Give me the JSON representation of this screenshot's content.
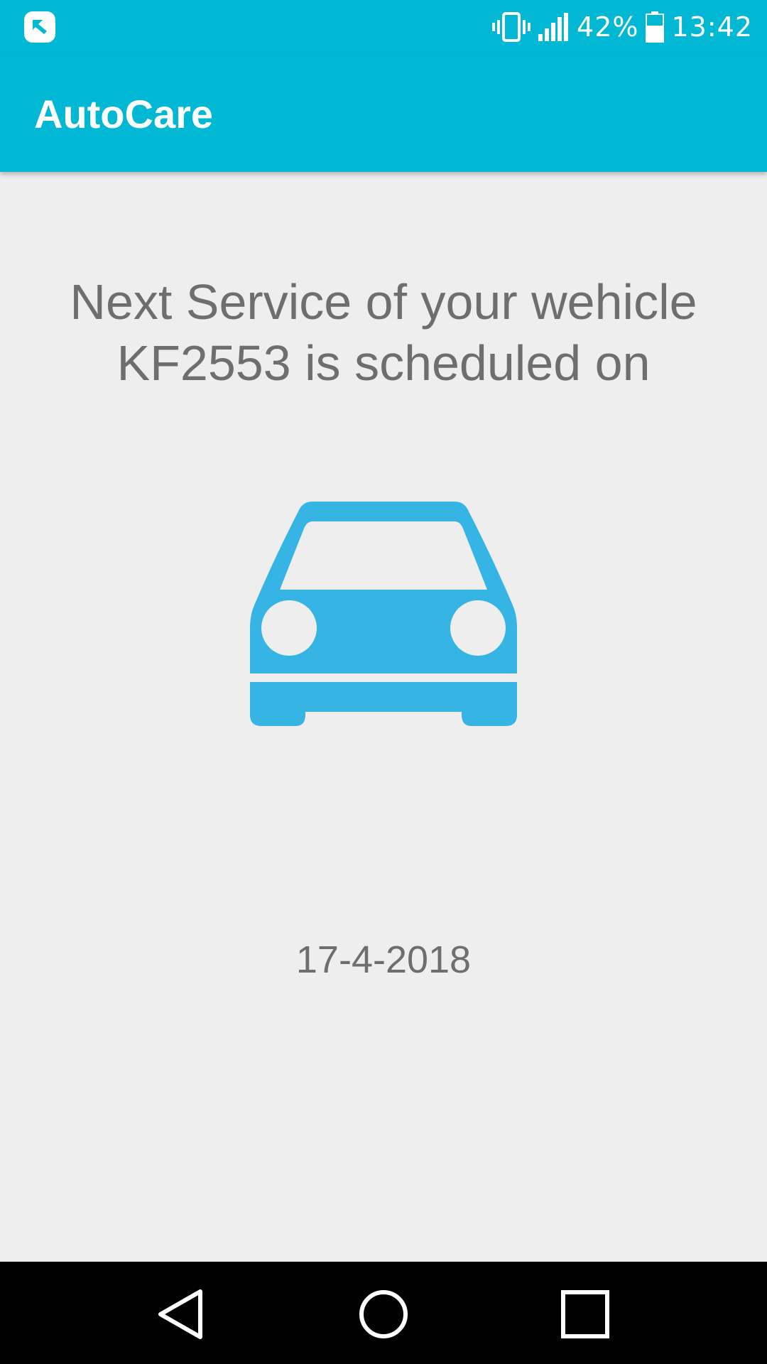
{
  "status_bar": {
    "battery_text": "42%",
    "time": "13:42",
    "icons": [
      "notification-app-icon",
      "vibrate-icon",
      "signal-icon",
      "battery-icon"
    ]
  },
  "app_bar": {
    "title": "AutoCare"
  },
  "main": {
    "message": "Next Service of your wehicle KF2553 is scheduled on",
    "icon": "car-icon",
    "date": "17-4-2018"
  },
  "nav_bar": {
    "buttons": [
      "back-icon",
      "home-icon",
      "recents-icon"
    ]
  },
  "colors": {
    "primary": "#00b8d4",
    "car_icon": "#36b5e4",
    "background": "#eeeeef",
    "text": "#6e6e6e"
  }
}
